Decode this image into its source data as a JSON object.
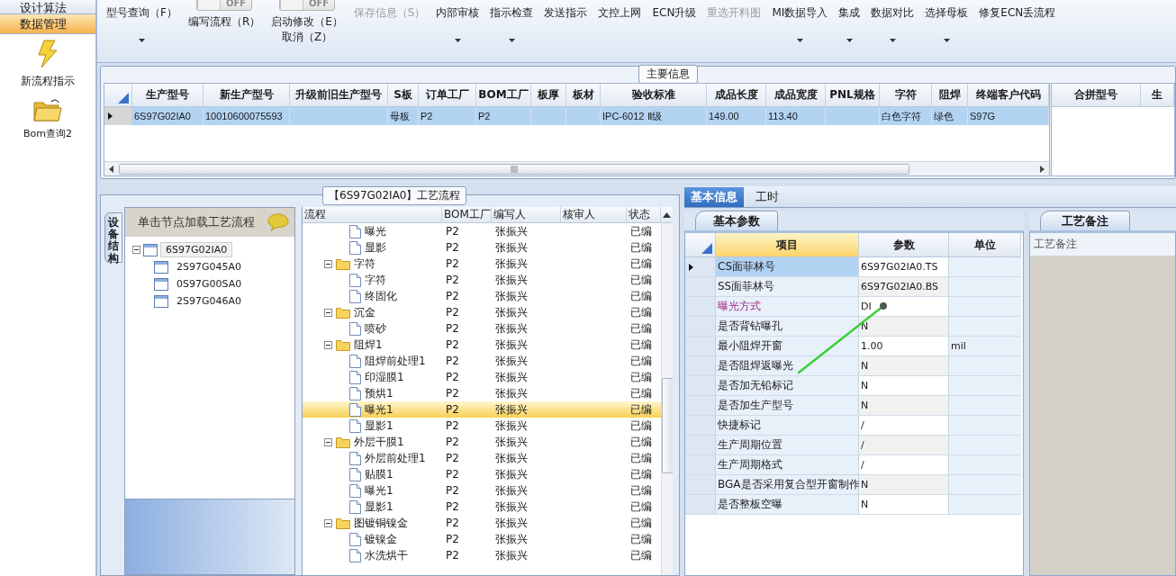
{
  "sidebar": {
    "groups": [
      {
        "label": "设计算法",
        "selected": false
      },
      {
        "label": "数据管理",
        "selected": true
      }
    ],
    "launchers": [
      {
        "label": "新流程指示",
        "kind": "lightning"
      },
      {
        "label": "Bom查询2",
        "kind": "folder"
      }
    ]
  },
  "ribbon": {
    "items": [
      {
        "kind": "button",
        "label": "型号查询（F）",
        "dropdown": true,
        "disabled": false
      },
      {
        "kind": "toggle",
        "label": "编写流程（R）",
        "toggle": {
          "text": "OFF",
          "on": false
        },
        "dropdown": false,
        "disabled": false
      },
      {
        "kind": "toggle",
        "label": "启动修改（E）",
        "sublabel": "取消（Z）",
        "toggle": {
          "text": "OFF",
          "on": false
        },
        "dropdown": false,
        "disabled": false
      },
      {
        "kind": "button",
        "label": "保存信息（S）",
        "dropdown": false,
        "disabled": true
      },
      {
        "kind": "button",
        "label": "内部审核",
        "dropdown": true,
        "disabled": false
      },
      {
        "kind": "button",
        "label": "指示检查",
        "dropdown": true,
        "disabled": false
      },
      {
        "kind": "button",
        "label": "发送指示",
        "dropdown": false,
        "disabled": false
      },
      {
        "kind": "button",
        "label": "文控上网",
        "dropdown": false,
        "disabled": false
      },
      {
        "kind": "button",
        "label": "ECN升级",
        "dropdown": false,
        "disabled": false
      },
      {
        "kind": "button",
        "label": "重选开料图",
        "dropdown": false,
        "disabled": true
      },
      {
        "kind": "button",
        "label": "MI数据导入",
        "dropdown": true,
        "disabled": false
      },
      {
        "kind": "button",
        "label": "集成",
        "dropdown": true,
        "disabled": false
      },
      {
        "kind": "button",
        "label": "数据对比",
        "dropdown": true,
        "disabled": false
      },
      {
        "kind": "button",
        "label": "选择母板",
        "dropdown": true,
        "disabled": false
      },
      {
        "kind": "button",
        "label": "修复ECN丢流程",
        "dropdown": false,
        "disabled": false
      }
    ]
  },
  "main_info": {
    "title": "主要信息",
    "columns": [
      "生产型号",
      "新生产型号",
      "升级前旧生产型号",
      "S板",
      "订单工厂",
      "BOM工厂",
      "板厚",
      "板材",
      "验收标准",
      "成品长度",
      "成品宽度",
      "PNL规格",
      "字符",
      "阻焊",
      "终端客户代码"
    ],
    "rows": [
      {
        "selected": true,
        "cells": [
          "6S97G02IA0",
          "10010600075593",
          "",
          "母板",
          "P2",
          "P2",
          "",
          "",
          "IPC-6012 Ⅱ级",
          "149.00",
          "113.40",
          "",
          "白色字符",
          "绿色",
          "S97G"
        ]
      }
    ],
    "side_columns": [
      "合拼型号",
      "生"
    ]
  },
  "process_panel": {
    "title": "【6S97G02IA0】工艺流程",
    "side_tab": "设备结构",
    "tree_hint": "单击节点加载工艺流程",
    "tree": [
      {
        "label": "6S97G02IA0",
        "selected": true,
        "expanded": true,
        "children": [
          {
            "label": "2S97G045A0",
            "selected": false
          },
          {
            "label": "0S97G00SA0",
            "selected": false
          },
          {
            "label": "2S97G046A0",
            "selected": false
          }
        ]
      }
    ],
    "flow": {
      "columns": [
        "流程",
        "BOM工厂",
        "编写人",
        "核审人",
        "状态"
      ],
      "rows": [
        {
          "kind": "step",
          "label": "曝光",
          "factory": "P2",
          "writer": "张振兴",
          "status": "已编",
          "selected": false
        },
        {
          "kind": "step",
          "label": "显影",
          "factory": "P2",
          "writer": "张振兴",
          "status": "已编",
          "selected": false
        },
        {
          "kind": "folder",
          "label": "字符",
          "factory": "P2",
          "writer": "张振兴",
          "status": "已编",
          "selected": false,
          "expanded": true,
          "children": [
            {
              "kind": "step",
              "label": "字符",
              "factory": "P2",
              "writer": "张振兴",
              "status": "已编",
              "selected": false
            },
            {
              "kind": "step",
              "label": "终固化",
              "factory": "P2",
              "writer": "张振兴",
              "status": "已编",
              "selected": false
            }
          ]
        },
        {
          "kind": "folder",
          "label": "沉金",
          "factory": "P2",
          "writer": "张振兴",
          "status": "已编",
          "selected": false,
          "expanded": true,
          "children": [
            {
              "kind": "step",
              "label": "喷砂",
              "factory": "P2",
              "writer": "张振兴",
              "status": "已编",
              "selected": false
            }
          ]
        },
        {
          "kind": "folder",
          "label": "阻焊1",
          "factory": "P2",
          "writer": "张振兴",
          "status": "已编",
          "selected": false,
          "expanded": true,
          "children": [
            {
              "kind": "step",
              "label": "阻焊前处理1",
              "factory": "P2",
              "writer": "张振兴",
              "status": "已编",
              "selected": false
            },
            {
              "kind": "step",
              "label": "印湿膜1",
              "factory": "P2",
              "writer": "张振兴",
              "status": "已编",
              "selected": false
            },
            {
              "kind": "step",
              "label": "预烘1",
              "factory": "P2",
              "writer": "张振兴",
              "status": "已编",
              "selected": false
            },
            {
              "kind": "step",
              "label": "曝光1",
              "factory": "P2",
              "writer": "张振兴",
              "status": "已编",
              "selected": true
            },
            {
              "kind": "step",
              "label": "显影1",
              "factory": "P2",
              "writer": "张振兴",
              "status": "已编",
              "selected": false
            }
          ]
        },
        {
          "kind": "folder",
          "label": "外层干膜1",
          "factory": "P2",
          "writer": "张振兴",
          "status": "已编",
          "selected": false,
          "expanded": true,
          "children": [
            {
              "kind": "step",
              "label": "外层前处理1",
              "factory": "P2",
              "writer": "张振兴",
              "status": "已编",
              "selected": false
            },
            {
              "kind": "step",
              "label": "贴膜1",
              "factory": "P2",
              "writer": "张振兴",
              "status": "已编",
              "selected": false
            },
            {
              "kind": "step",
              "label": "曝光1",
              "factory": "P2",
              "writer": "张振兴",
              "status": "已编",
              "selected": false
            },
            {
              "kind": "step",
              "label": "显影1",
              "factory": "P2",
              "writer": "张振兴",
              "status": "已编",
              "selected": false
            }
          ]
        },
        {
          "kind": "folder",
          "label": "图镀铜镍金",
          "factory": "P2",
          "writer": "张振兴",
          "status": "已编",
          "selected": false,
          "expanded": true,
          "children": [
            {
              "kind": "step",
              "label": "镀镍金",
              "factory": "P2",
              "writer": "张振兴",
              "status": "已编",
              "selected": false
            },
            {
              "kind": "step",
              "label": "水洗烘干",
              "factory": "P2",
              "writer": "张振兴",
              "status": "已编",
              "selected": false
            }
          ]
        }
      ]
    }
  },
  "detail": {
    "tabs": [
      {
        "label": "基本信息",
        "selected": true
      },
      {
        "label": "工时",
        "selected": false
      }
    ],
    "params": {
      "title": "基本参数",
      "columns": [
        "项目",
        "参数",
        "单位"
      ],
      "rows": [
        {
          "item": "CS面菲林号",
          "value": "6S97G02IA0.TS",
          "selected": true,
          "highlighted": false
        },
        {
          "item": "SS面菲林号",
          "value": "6S97G02IA0.BS",
          "selected": false,
          "highlighted": false
        },
        {
          "item": "曝光方式",
          "value": "DI",
          "selected": false,
          "highlighted": true
        },
        {
          "item": "是否背钻曝孔",
          "value": "N",
          "selected": false,
          "highlighted": false
        },
        {
          "item": "最小阻焊开窗",
          "value": "1.00",
          "unit": "mil",
          "selected": false,
          "highlighted": false
        },
        {
          "item": "是否阻焊返曝光",
          "value": "N",
          "selected": false,
          "highlighted": false
        },
        {
          "item": "是否加无铅标记",
          "value": "N",
          "selected": false,
          "highlighted": false
        },
        {
          "item": "是否加生产型号",
          "value": "N",
          "selected": false,
          "highlighted": false
        },
        {
          "item": "快捷标记",
          "value": "/",
          "selected": false,
          "highlighted": false
        },
        {
          "item": "生产周期位置",
          "value": "/",
          "selected": false,
          "highlighted": false
        },
        {
          "item": "生产周期格式",
          "value": "/",
          "selected": false,
          "highlighted": false
        },
        {
          "item": "BGA是否采用复合型开窗制作",
          "value": "N",
          "selected": false,
          "highlighted": false
        },
        {
          "item": "是否整板空曝",
          "value": "N",
          "selected": false,
          "highlighted": false
        }
      ]
    },
    "notes": {
      "title": "工艺备注",
      "header": "工艺备注"
    }
  }
}
